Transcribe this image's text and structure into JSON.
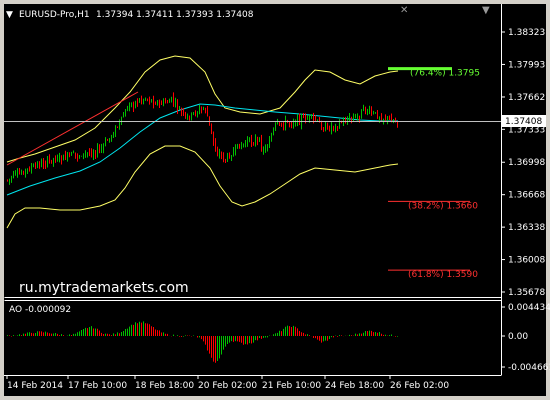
{
  "window": {
    "title": "EURUSD-Pro,H1",
    "ohlc": "1.37394 1.37411 1.37393 1.37408",
    "watermark": "ru.mytrademarkets.com",
    "controls": [
      "▼",
      "✕"
    ]
  },
  "colors": {
    "background": "#000000",
    "foreground": "#ffffff",
    "bull": "#00c000",
    "bear": "#ff0000",
    "ma": "#00e5ee",
    "bands": "#ffff66",
    "trend": "#ff3030",
    "fib_up": "#66ff33",
    "fib_down": "#ff3030"
  },
  "price_axis": {
    "ticks": [
      "1.38323",
      "1.37993",
      "1.37662",
      "1.37333",
      "1.36998",
      "1.36668",
      "1.36338",
      "1.36008",
      "1.35678"
    ],
    "current_price": "1.37408"
  },
  "levels": [
    {
      "label": "(76.4%) 1.3795",
      "price": 1.3795,
      "color": "#66ff33"
    },
    {
      "label": "(38.2%) 1.3660",
      "price": 1.366,
      "color": "#ff3030"
    },
    {
      "label": "(61.8%) 1.3590",
      "price": 1.359,
      "color": "#ff3030"
    }
  ],
  "indicator": {
    "label": "AO -0.000092",
    "ticks": [
      "0.004434",
      "0.00",
      "-0.004661"
    ]
  },
  "time_axis": {
    "labels": [
      "14 Feb 2014",
      "17 Feb 10:00",
      "18 Feb 18:00",
      "20 Feb 02:00",
      "21 Feb 10:00",
      "24 Feb 18:00",
      "26 Feb 02:00"
    ]
  }
}
